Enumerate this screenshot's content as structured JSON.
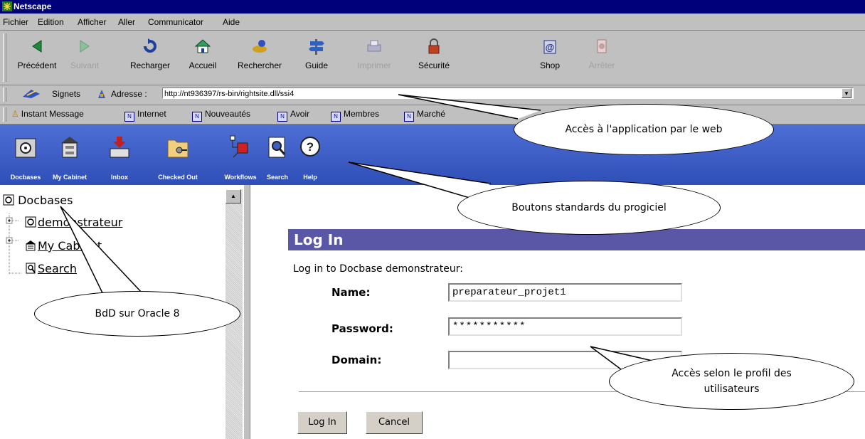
{
  "window": {
    "title": "Netscape"
  },
  "menu": [
    "Fichier",
    "Edition",
    "Afficher",
    "Aller",
    "Communicator",
    "Aide"
  ],
  "toolbar": [
    {
      "label": "Précédent",
      "icon": "back-arrow-icon",
      "enabled": true
    },
    {
      "label": "Suivant",
      "icon": "forward-arrow-icon",
      "enabled": false
    },
    {
      "label": "Recharger",
      "icon": "reload-icon",
      "enabled": true
    },
    {
      "label": "Accueil",
      "icon": "home-icon",
      "enabled": true
    },
    {
      "label": "Rechercher",
      "icon": "search-icon",
      "enabled": true
    },
    {
      "label": "Guide",
      "icon": "guide-icon",
      "enabled": true
    },
    {
      "label": "Imprimer",
      "icon": "print-icon",
      "enabled": false
    },
    {
      "label": "Sécurité",
      "icon": "lock-icon",
      "enabled": true
    },
    {
      "label": "Shop",
      "icon": "shop-icon",
      "enabled": true
    },
    {
      "label": "Arrêter",
      "icon": "stop-icon",
      "enabled": false
    }
  ],
  "location": {
    "bookmarks_label": "Signets",
    "address_label": "Adresse :",
    "url": "http://nt936397/rs-bin/rightsite.dll/ssi4"
  },
  "personal_bar": [
    "Instant Message",
    "Internet",
    "Nouveautés",
    "Avoir",
    "Membres",
    "Marché"
  ],
  "app_toolbar": [
    "Docbases",
    "My Cabinet",
    "Inbox",
    "Checked Out",
    "Workflows",
    "Search",
    "Help"
  ],
  "tree": {
    "root": "Docbases",
    "items": [
      "demonstrateur",
      "My Cabinet",
      "Search"
    ]
  },
  "login": {
    "header": "Log In",
    "subtitle": "Log in to Docbase demonstrateur:",
    "name_label": "Name:",
    "name_value": "preparateur_projet1",
    "password_label": "Password:",
    "password_value": "***********",
    "domain_label": "Domain:",
    "domain_value": "",
    "login_button": "Log In",
    "cancel_button": "Cancel"
  },
  "callouts": {
    "web_access": "Accès à l'application par le web",
    "standard_buttons": "Boutons standards du progiciel",
    "oracle_db": "BdD sur Oracle 8",
    "profile_access": "Accès selon le profil des utilisateurs"
  },
  "colors": {
    "titlebar": "#00007b",
    "app_toolbar": "#3e5fc6",
    "login_header": "#5a58a6",
    "chrome": "#c0c0c0"
  }
}
